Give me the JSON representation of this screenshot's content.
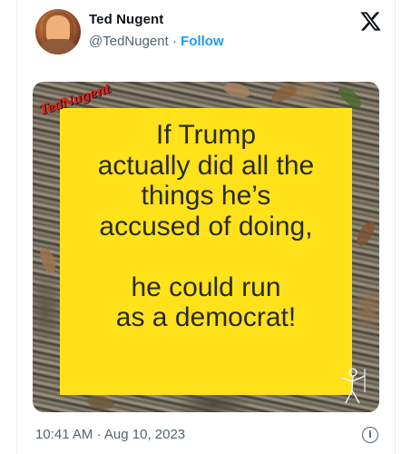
{
  "tweet": {
    "author_name": "Ted Nugent",
    "handle": "@TedNugent",
    "separator": " · ",
    "follow_label": "Follow",
    "timestamp": "10:41 AM · Aug 10, 2023",
    "info_glyph": "i"
  },
  "image": {
    "brand_text": "TedNugent",
    "quote_lines_top": [
      "If Trump",
      "actually did all the",
      "things he’s",
      "accused of doing,"
    ],
    "quote_lines_bottom": [
      "he could run",
      "as a democrat!"
    ]
  },
  "colors": {
    "accent": "#1d9bf0",
    "sign_yellow": "#ffe21a",
    "brand_red": "#d8241f",
    "muted_text": "#536471"
  },
  "icons": {
    "logo": "x-logo-icon",
    "info": "info-icon"
  }
}
